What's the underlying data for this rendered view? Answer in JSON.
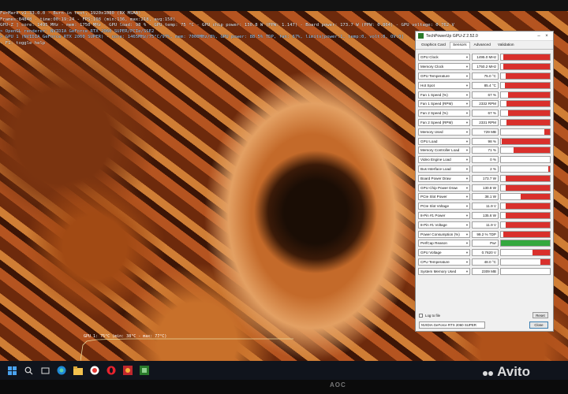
{
  "overlay": {
    "lines": [
      "FurMark v1.33.0.0 - Burn-in test, 1920x1080 (8X MSAA)",
      "Frames:84848 - time:00:19:24 - FPS:108 (min:136, max:218, avg:158)",
      "GPU-Z ] core: 1495 MHz - mem: 1750 MHz - GPU load: 98 % - GPU temp: 75 °C - GPU chip power: 130.8 W (PPW: 1.147) - Board power: 173.7 W (PPW: 0.864) - GPU voltage: 0.762 V",
      "> OpenGL renderer: NVIDIA GeForce RTX 2060 SUPER/PCIe/SSE2",
      "> GPU 1 (NVIDIA GeForce RTX 2060 SUPER) - core: 1465MHz/75°C/97%, mem: 7000MHz/8%, GPU power: 88.5% TDP, fan: 67%, limits[power:1, temp:0, volt:0, OV:0]",
      "- F1: toggle help"
    ],
    "graph_label": "GPU 1: 75°C (min: 38°C - max: 77°C)"
  },
  "gpuz": {
    "title": "TechPowerUp GPU-Z 2.52.0",
    "tabs": [
      "Graphics Card",
      "Sensors",
      "Advanced",
      "Validation"
    ],
    "rows": [
      {
        "name": "GPU Clock",
        "value": "1495.0 MHz",
        "level": 0.95,
        "color": "#d9302c"
      },
      {
        "name": "Memory Clock",
        "value": "1750.2 MHz",
        "level": 0.95,
        "color": "#d9302c"
      },
      {
        "name": "GPU Temperature",
        "value": "75.0 °C",
        "level": 0.9,
        "color": "#d9302c"
      },
      {
        "name": "Hot Spot",
        "value": "85.4 °C",
        "level": 0.92,
        "color": "#d9302c"
      },
      {
        "name": "Fan 1 Speed (%)",
        "value": "67 %",
        "level": 0.85,
        "color": "#d9302c"
      },
      {
        "name": "Fan 1 Speed (RPM)",
        "value": "2332 RPM",
        "level": 0.88,
        "color": "#d9302c"
      },
      {
        "name": "Fan 2 Speed (%)",
        "value": "67 %",
        "level": 0.85,
        "color": "#d9302c"
      },
      {
        "name": "Fan 2 Speed (RPM)",
        "value": "2331 RPM",
        "level": 0.88,
        "color": "#d9302c"
      },
      {
        "name": "Memory Used",
        "value": "729 MB",
        "level": 0.12,
        "color": "#d9302c"
      },
      {
        "name": "GPU Load",
        "value": "98 %",
        "level": 0.98,
        "color": "#d9302c"
      },
      {
        "name": "Memory Controller Load",
        "value": "71 %",
        "level": 0.75,
        "color": "#d9302c"
      },
      {
        "name": "Video Engine Load",
        "value": "0 %",
        "level": 0,
        "color": "#d9302c"
      },
      {
        "name": "Bus Interface Load",
        "value": "2 %",
        "level": 0.03,
        "color": "#d9302c"
      },
      {
        "name": "Board Power Draw",
        "value": "173.7 W",
        "level": 0.9,
        "color": "#d9302c"
      },
      {
        "name": "GPU Chip Power Draw",
        "value": "130.8 W",
        "level": 0.9,
        "color": "#d9302c"
      },
      {
        "name": "PCIe Slot Power",
        "value": "38.1 W",
        "level": 0.6,
        "color": "#d9302c"
      },
      {
        "name": "PCIe Slot Voltage",
        "value": "11.9 V",
        "level": 0.9,
        "color": "#d9302c"
      },
      {
        "name": "8-Pin #1 Power",
        "value": "135.6 W",
        "level": 0.9,
        "color": "#d9302c"
      },
      {
        "name": "8-Pin #1 Voltage",
        "value": "11.9 V",
        "level": 0.9,
        "color": "#d9302c"
      },
      {
        "name": "Power Consumption (%)",
        "value": "99.2 % TDP",
        "level": 0.95,
        "color": "#d9302c"
      },
      {
        "name": "PerfCap Reason",
        "value": "Pwr",
        "level": 1,
        "color": "#34a83e"
      },
      {
        "name": "GPU Voltage",
        "value": "0.7620 V",
        "level": 0.35,
        "color": "#d9302c"
      },
      {
        "name": "CPU Temperature",
        "value": "48.0 °C",
        "level": 0.2,
        "color": "#d9302c"
      },
      {
        "name": "System Memory Used",
        "value": "2309 MB",
        "level": 0,
        "color": "#d9302c"
      }
    ],
    "log_label": "Log to file",
    "reset_label": "Reset",
    "gpu_select": "NVIDIA GeForce RTX 2060 SUPER",
    "close_label": "Close"
  },
  "monitor": {
    "brand": "AOC"
  },
  "watermark": "Avito"
}
